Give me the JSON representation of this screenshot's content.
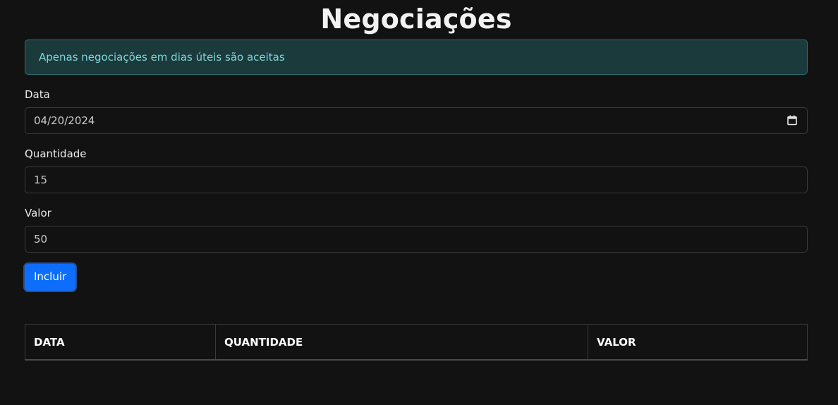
{
  "page": {
    "title": "Negociações"
  },
  "alert": {
    "text": "Apenas negociações em dias úteis são aceitas"
  },
  "form": {
    "data_label": "Data",
    "data_value": "04/20/2024",
    "quantidade_label": "Quantidade",
    "quantidade_value": "15",
    "valor_label": "Valor",
    "valor_value": "50",
    "submit_label": "Incluir"
  },
  "table": {
    "headers": [
      "DATA",
      "QUANTIDADE",
      "VALOR"
    ]
  },
  "colors": {
    "background": "#121212",
    "alert_background": "#1b3a3c",
    "alert_text": "#7ed6d6",
    "button": "#0d6efd"
  }
}
